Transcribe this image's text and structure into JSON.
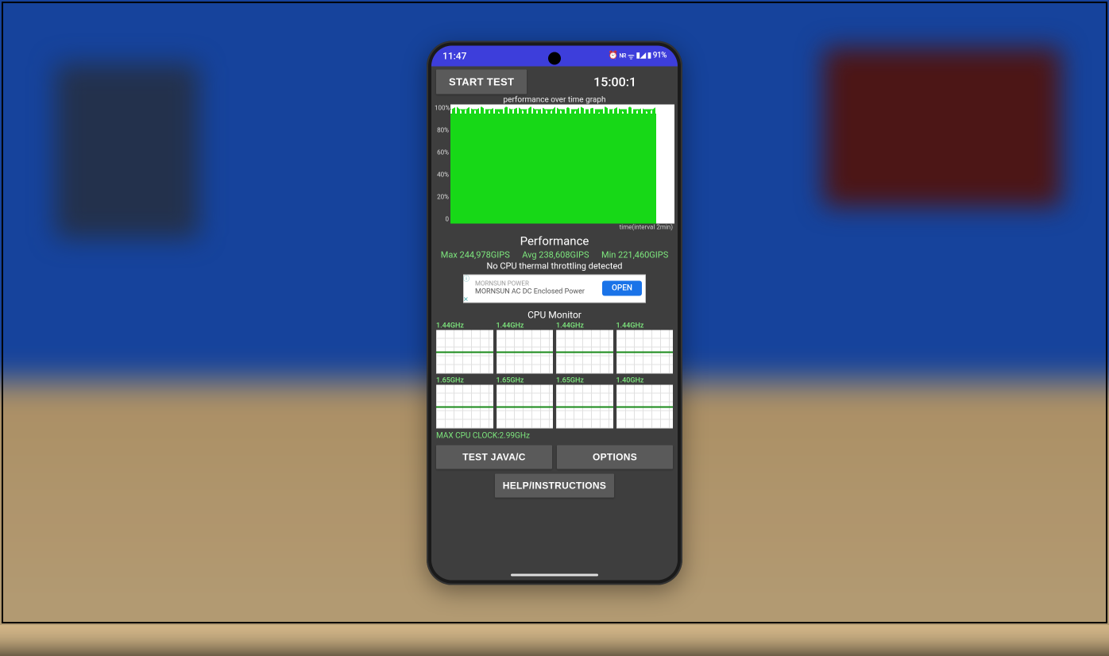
{
  "statusbar": {
    "time": "11:47",
    "battery": "91%",
    "icons_text": "⏰ᴺᴿ ᯤ ▀ ▮◢"
  },
  "app": {
    "start_button": "START TEST",
    "timer": "15:00:1",
    "graph_title": "performance over time graph",
    "y_ticks": [
      "100%",
      "80%",
      "60%",
      "40%",
      "20%",
      "0"
    ],
    "x_axis_label": "time(interval 2min)",
    "performance_title": "Performance",
    "perf_max": "Max 244,978GIPS",
    "perf_avg": "Avg 238,608GIPS",
    "perf_min": "Min 221,460GIPS",
    "throttle_msg": "No CPU thermal throttling detected",
    "ad": {
      "line1": "MORNSUN POWER",
      "line2": "MORNSUN AC DC Enclosed Power",
      "cta": "OPEN"
    },
    "cpu_monitor_title": "CPU Monitor",
    "cores": [
      "1.44GHz",
      "1.44GHz",
      "1.44GHz",
      "1.44GHz",
      "1.65GHz",
      "1.65GHz",
      "1.65GHz",
      "1.40GHz"
    ],
    "max_clock": "MAX CPU CLOCK:2.99GHz",
    "buttons": {
      "test_java_c": "TEST JAVA/C",
      "options": "OPTIONS",
      "help": "HELP/INSTRUCTIONS"
    }
  },
  "chart_data": {
    "type": "area",
    "title": "performance over time graph",
    "xlabel": "time (interval 2min)",
    "ylabel": "Performance %",
    "ylim": [
      0,
      100
    ],
    "x_range_minutes": [
      0,
      15
    ],
    "series": [
      {
        "name": "performance",
        "values": [
          98,
          97,
          96,
          98,
          95,
          97,
          96,
          98,
          94,
          97,
          96,
          98,
          95,
          97,
          96,
          98,
          94,
          97,
          96,
          98,
          95,
          97,
          96,
          98,
          93,
          97,
          96,
          98,
          95,
          97
        ]
      }
    ],
    "stats": {
      "max_gips": 244978,
      "avg_gips": 238608,
      "min_gips": 221460
    },
    "cpu_cores_ghz": [
      1.44,
      1.44,
      1.44,
      1.44,
      1.65,
      1.65,
      1.65,
      1.4
    ],
    "max_cpu_clock_ghz": 2.99
  }
}
